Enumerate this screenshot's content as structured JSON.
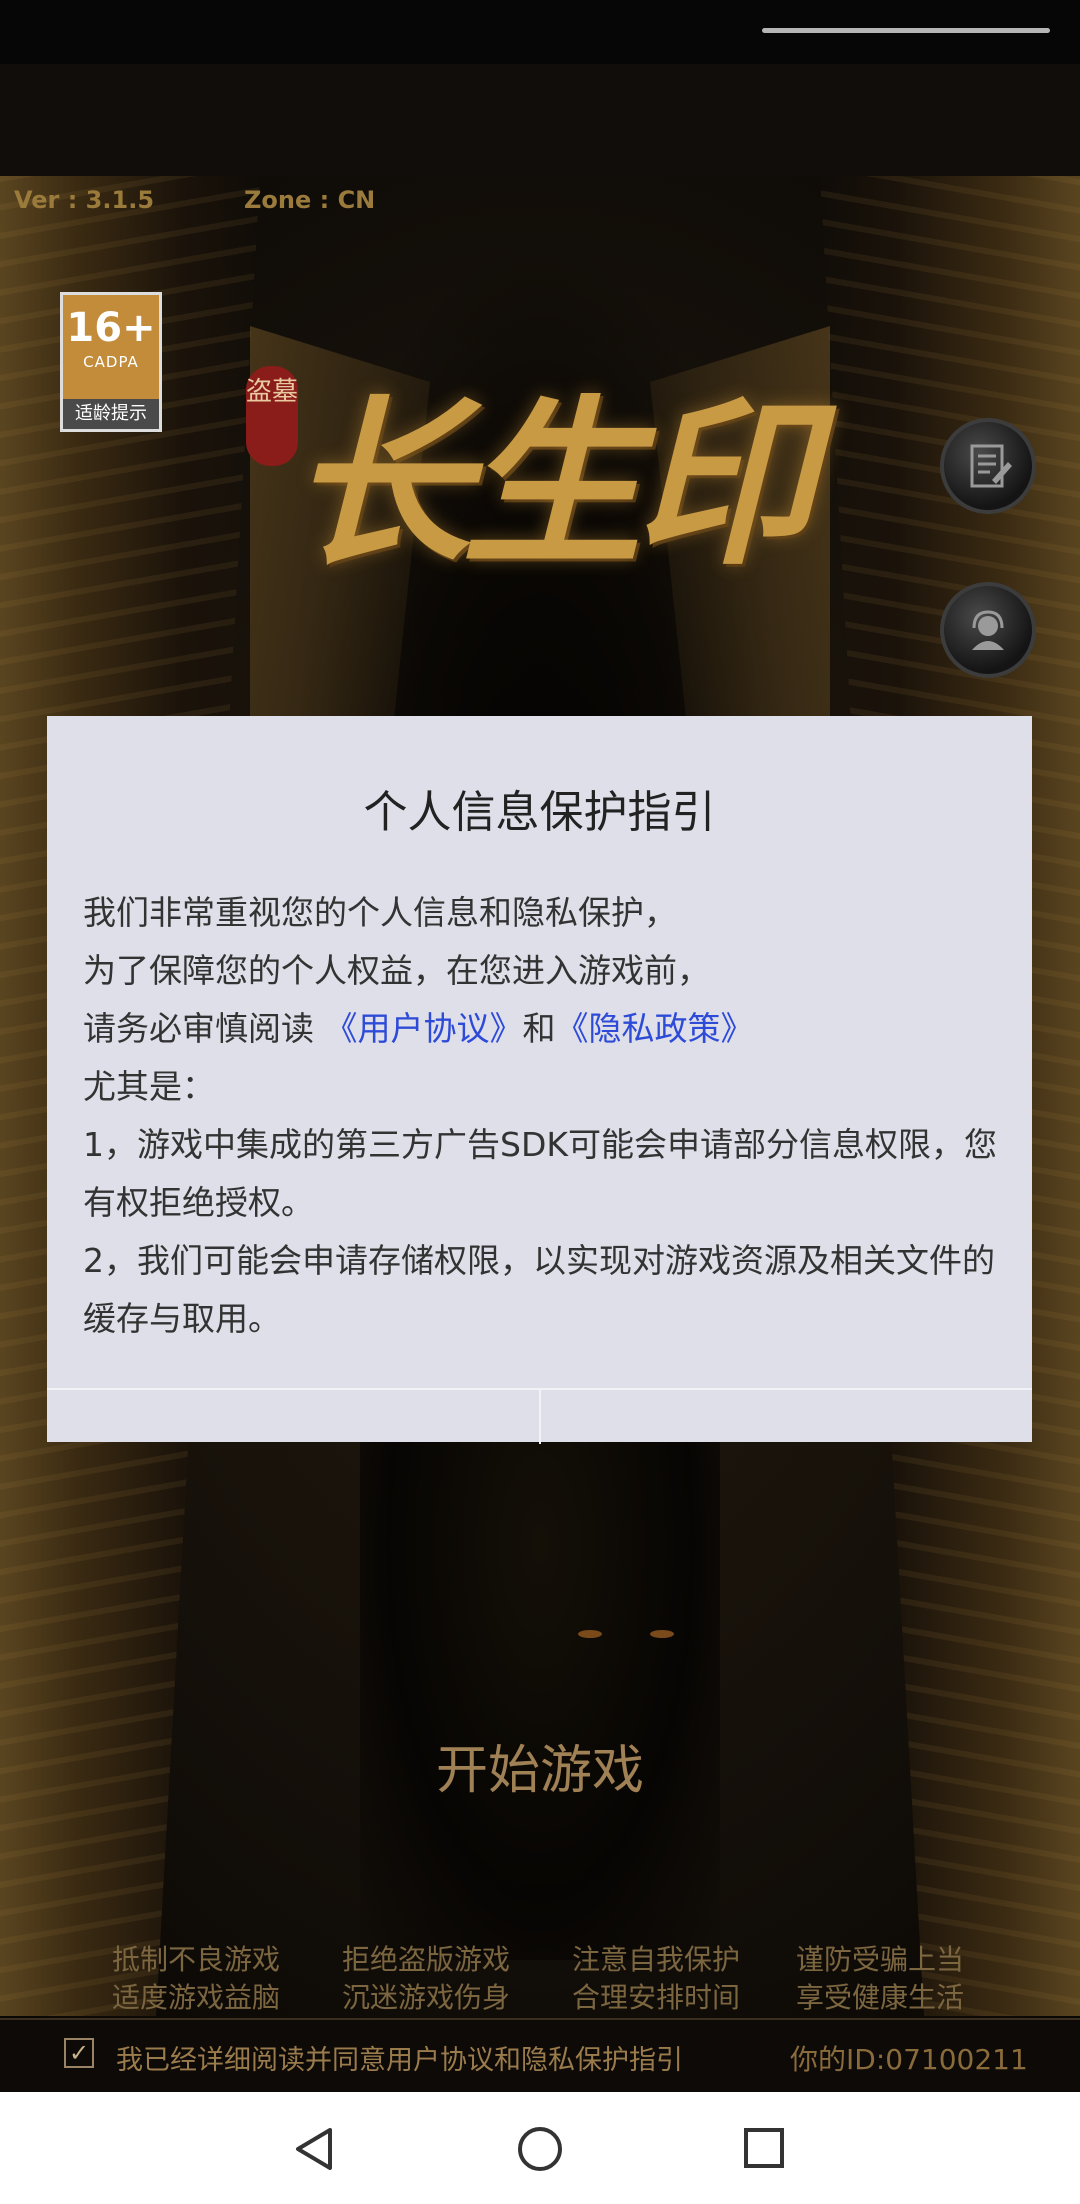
{
  "game": {
    "version": "Ver : 3.1.5",
    "zone": "Zone : CN",
    "age_rating": {
      "number": "16+",
      "org": "CADPA",
      "tip": "适龄提示"
    },
    "logo": {
      "seal": "盗墓",
      "title": "长生印"
    },
    "start_label": "开始游戏",
    "health_tips": [
      [
        "抵制不良游戏",
        "拒绝盗版游戏",
        "注意自我保护",
        "谨防受骗上当"
      ],
      [
        "适度游戏益脑",
        "沉迷游戏伤身",
        "合理安排时间",
        "享受健康生活"
      ]
    ],
    "agreement": "我已经详细阅读并同意用户协议和隐私保护指引",
    "user_id": "你的ID:07100211"
  },
  "dialog": {
    "title": "个人信息保护指引",
    "line1": "我们非常重视您的个人信息和隐私保护，",
    "line2": "为了保障您的个人权益，在您进入游戏前，",
    "line3_prefix": "请务必审慎阅读",
    "user_agreement": "《用户协议》",
    "line3_and": "和",
    "privacy_policy": "《隐私政策》",
    "line4": "尤其是：",
    "item1": "1，游戏中集成的第三方广告SDK可能会申请部分信息权限，您有权拒绝授权。",
    "item2": "2，我们可能会申请存储权限，以实现对游戏资源及相关文件的缓存与取用。",
    "left_button": "",
    "right_button": ""
  },
  "colors": {
    "link": "#2e4bd8",
    "dialog_bg": "#dfdfe9",
    "gold": "#c99a44"
  },
  "icons": [
    "notice-icon",
    "customer-service-icon",
    "back-icon",
    "home-icon",
    "recents-icon",
    "check-icon"
  ]
}
